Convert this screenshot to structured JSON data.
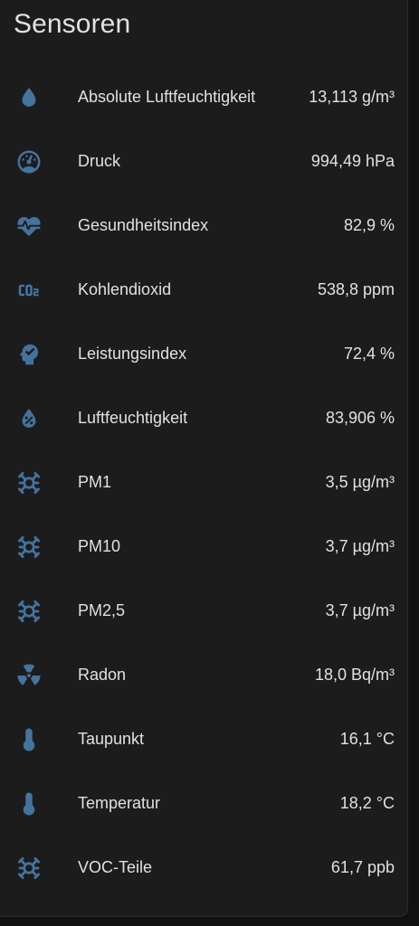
{
  "card": {
    "title": "Sensoren"
  },
  "colors": {
    "icon": "#44739e",
    "text": "#e1e1e1",
    "card_bg": "#1c1c1c",
    "page_bg": "#111111"
  },
  "sensors": [
    {
      "name": "Absolute Luftfeuchtigkeit",
      "value": "13,113 g/m³",
      "icon": "water-drop-icon"
    },
    {
      "name": "Druck",
      "value": "994,49 hPa",
      "icon": "gauge-icon"
    },
    {
      "name": "Gesundheitsindex",
      "value": "82,9 %",
      "icon": "heart-pulse-icon"
    },
    {
      "name": "Kohlendioxid",
      "value": "538,8 ppm",
      "icon": "co2-icon"
    },
    {
      "name": "Leistungsindex",
      "value": "72,4 %",
      "icon": "head-check-icon"
    },
    {
      "name": "Luftfeuchtigkeit",
      "value": "83,906 %",
      "icon": "water-percent-icon"
    },
    {
      "name": "PM1",
      "value": "3,5 µg/m³",
      "icon": "particles-icon"
    },
    {
      "name": "PM10",
      "value": "3,7 µg/m³",
      "icon": "particles-icon"
    },
    {
      "name": "PM2,5",
      "value": "3,7 µg/m³",
      "icon": "particles-icon"
    },
    {
      "name": "Radon",
      "value": "18,0 Bq/m³",
      "icon": "radioactive-icon"
    },
    {
      "name": "Taupunkt",
      "value": "16,1 °C",
      "icon": "thermometer-icon"
    },
    {
      "name": "Temperatur",
      "value": "18,2 °C",
      "icon": "thermometer-icon"
    },
    {
      "name": "VOC-Teile",
      "value": "61,7 ppb",
      "icon": "particles-icon"
    }
  ]
}
